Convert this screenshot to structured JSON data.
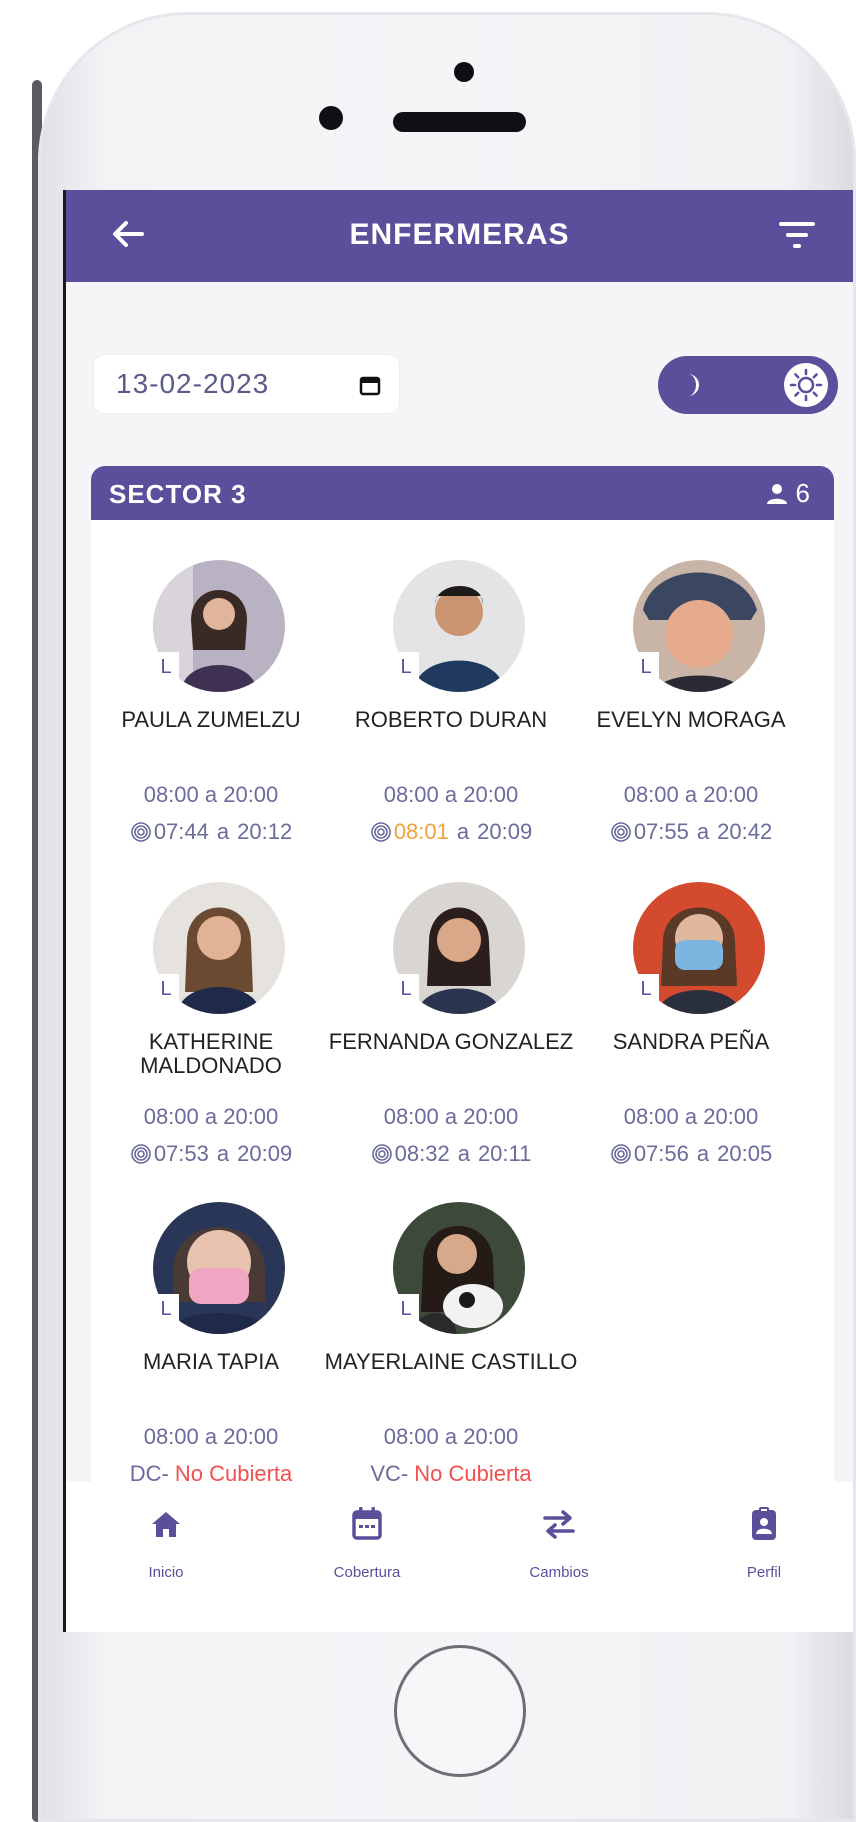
{
  "header": {
    "title": "ENFERMERAS"
  },
  "date_field": {
    "value": "13-02-2023"
  },
  "sector": {
    "title": "SECTOR 3",
    "count": "6"
  },
  "nurses": [
    {
      "name": "PAULA ZUMELZU",
      "badge": "L",
      "schedule": "08:00 a 20:00",
      "check_in": "07:44",
      "sep": "a",
      "check_out": "20:12",
      "late": false
    },
    {
      "name": "ROBERTO DURAN",
      "badge": "L",
      "schedule": "08:00 a 20:00",
      "check_in": "08:01",
      "sep": "a",
      "check_out": "20:09",
      "late": true
    },
    {
      "name": "EVELYN MORAGA",
      "badge": "L",
      "schedule": "08:00 a 20:00",
      "check_in": "07:55",
      "sep": "a",
      "check_out": "20:42",
      "late": false
    },
    {
      "name": "KATHERINE MALDONADO",
      "badge": "L",
      "schedule": "08:00 a 20:00",
      "check_in": "07:53",
      "sep": "a",
      "check_out": "20:09",
      "late": false
    },
    {
      "name": "FERNANDA GONZALEZ",
      "badge": "L",
      "schedule": "08:00 a 20:00",
      "check_in": "08:32",
      "sep": "a",
      "check_out": "20:11",
      "late": false
    },
    {
      "name": "SANDRA PEÑA",
      "badge": "L",
      "schedule": "08:00 a 20:00",
      "check_in": "07:56",
      "sep": "a",
      "check_out": "20:05",
      "late": false
    },
    {
      "name": "MARIA TAPIA",
      "badge": "L",
      "schedule": "08:00 a 20:00",
      "status_prefix": "DC-",
      "status": "No Cubierta"
    },
    {
      "name": "MAYERLAINE CASTILLO",
      "badge": "L",
      "schedule": "08:00 a 20:00",
      "status_prefix": "VC-",
      "status": "No Cubierta"
    }
  ],
  "nav": {
    "items": [
      {
        "label": "Inicio",
        "icon": "home-icon"
      },
      {
        "label": "Cobertura",
        "icon": "calendar-icon"
      },
      {
        "label": "Cambios",
        "icon": "swap-arrows-icon"
      },
      {
        "label": "Perfil",
        "icon": "clipboard-profile-icon"
      }
    ]
  },
  "colors": {
    "primary": "#5b4f9b",
    "late": "#f0a33a",
    "not_covered": "#f05050",
    "schedule_text": "#6b6b9c"
  }
}
